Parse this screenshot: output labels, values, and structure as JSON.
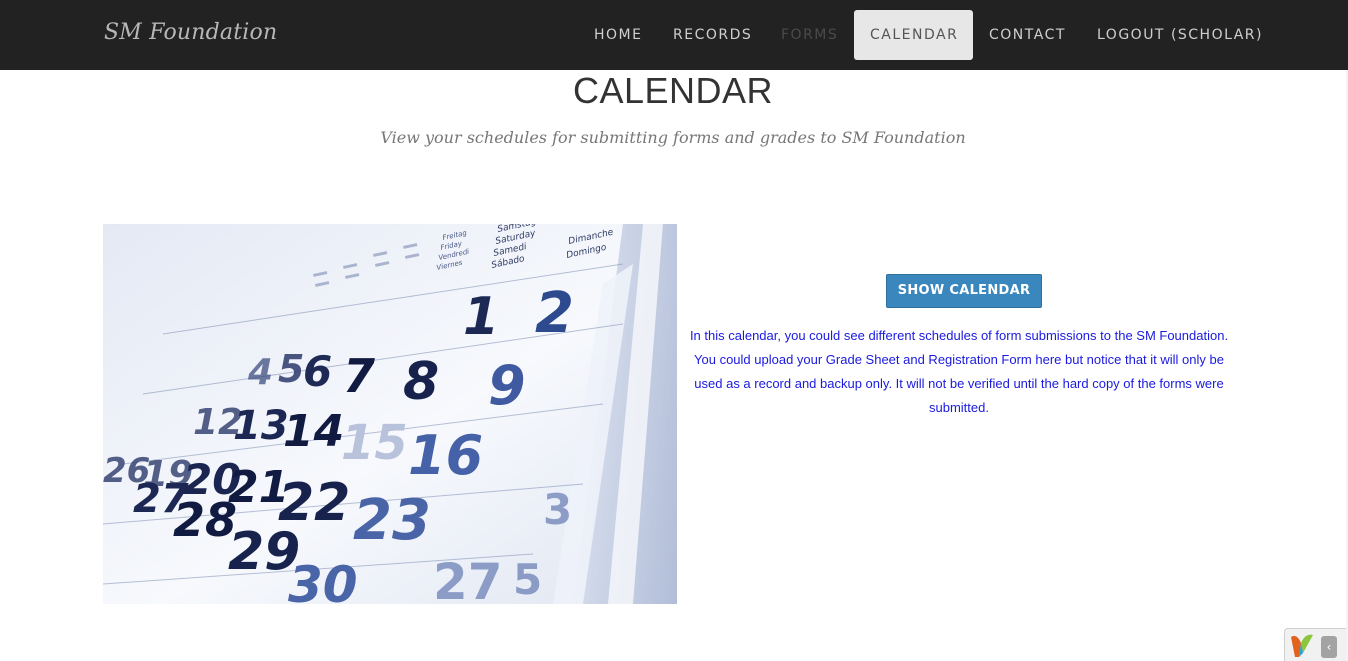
{
  "brand": "SM Foundation",
  "nav": {
    "home": "HOME",
    "records": "RECORDS",
    "forms": "FORMS",
    "calendar": "CALENDAR",
    "contact": "CONTACT",
    "logout": "LOGOUT (SCHOLAR)"
  },
  "page": {
    "title": "CALENDAR",
    "subtitle": "View your schedules for submitting forms and grades to SM Foundation"
  },
  "calendar_image": {
    "weekdays_sat": [
      "Samstag",
      "Saturday",
      "Samedi",
      "Sábado"
    ],
    "weekdays_sun": [
      "Dimanche",
      "Domingo"
    ],
    "weekdays_fri": [
      "Freitag",
      "Friday",
      "Vendredi",
      "Viernes"
    ],
    "numbers_row1": [
      "1",
      "2"
    ],
    "numbers_row2": [
      "4",
      "5",
      "6",
      "7",
      "8",
      "9"
    ],
    "numbers_row3": [
      "12",
      "13",
      "14",
      "15",
      "16"
    ],
    "numbers_row4": [
      "19",
      "20",
      "21",
      "22",
      "23"
    ],
    "numbers_row5": [
      "26",
      "27",
      "28",
      "29",
      "30"
    ]
  },
  "panel": {
    "button_label": "SHOW CALENDAR",
    "info_text": "In this calendar, you could see different schedules of form submissions to the SM Foundation. You could upload your Grade Sheet and Registration Form here but notice that it will only be used as a record and backup only. It will not be verified until the hard copy of the forms were submitted."
  },
  "widget": {
    "arrow_icon": "chevron-left-icon"
  },
  "colors": {
    "navbar": "#222222",
    "active_tab": "#e7e7e7",
    "button": "#3a87bd",
    "info_text": "#1a1ae0"
  }
}
